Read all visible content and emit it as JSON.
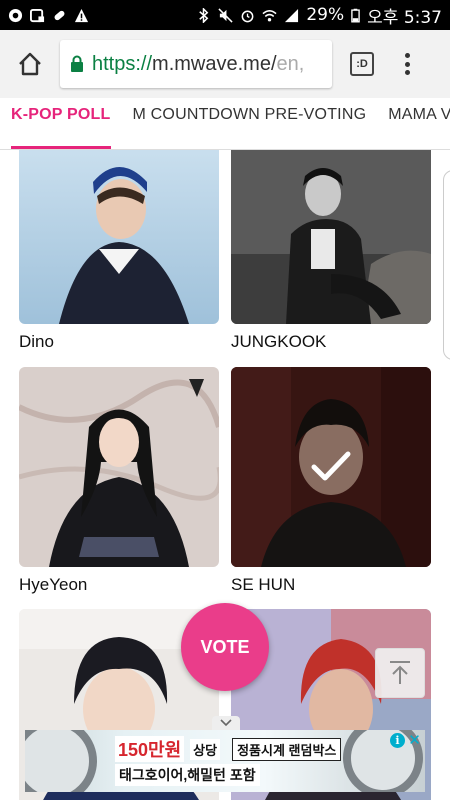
{
  "status_bar": {
    "battery_percent": "29%",
    "time": "오후 5:37"
  },
  "browser": {
    "url_scheme": "https://",
    "url_host": "m.mwave.me/",
    "url_path_visible": "en,",
    "tabs_label": ":D"
  },
  "site_tabs": [
    {
      "label": "K-POP POLL",
      "active": true
    },
    {
      "label": "M COUNTDOWN PRE-VOTING",
      "active": false
    },
    {
      "label": "MAMA VOT",
      "active": false
    }
  ],
  "candidates": [
    {
      "name": "Dino",
      "selected": false
    },
    {
      "name": "JUNGKOOK",
      "selected": false
    },
    {
      "name": "HyeYeon",
      "selected": false
    },
    {
      "name": "SE HUN",
      "selected": true
    },
    {
      "name": "",
      "selected": false
    },
    {
      "name": "",
      "selected": false
    }
  ],
  "vote_button": {
    "label": "VOTE"
  },
  "ad": {
    "price_text": "150만원",
    "tag1": "상당",
    "tag2": "정품시계 랜덤박스",
    "line2": "태그호이어,해밀턴 포함",
    "info_label": "i",
    "close_label": "✕"
  },
  "colors": {
    "accent": "#e6247b",
    "vote": "#ea3d8a",
    "url_green": "#0b8043",
    "ad_info": "#00aecd"
  }
}
